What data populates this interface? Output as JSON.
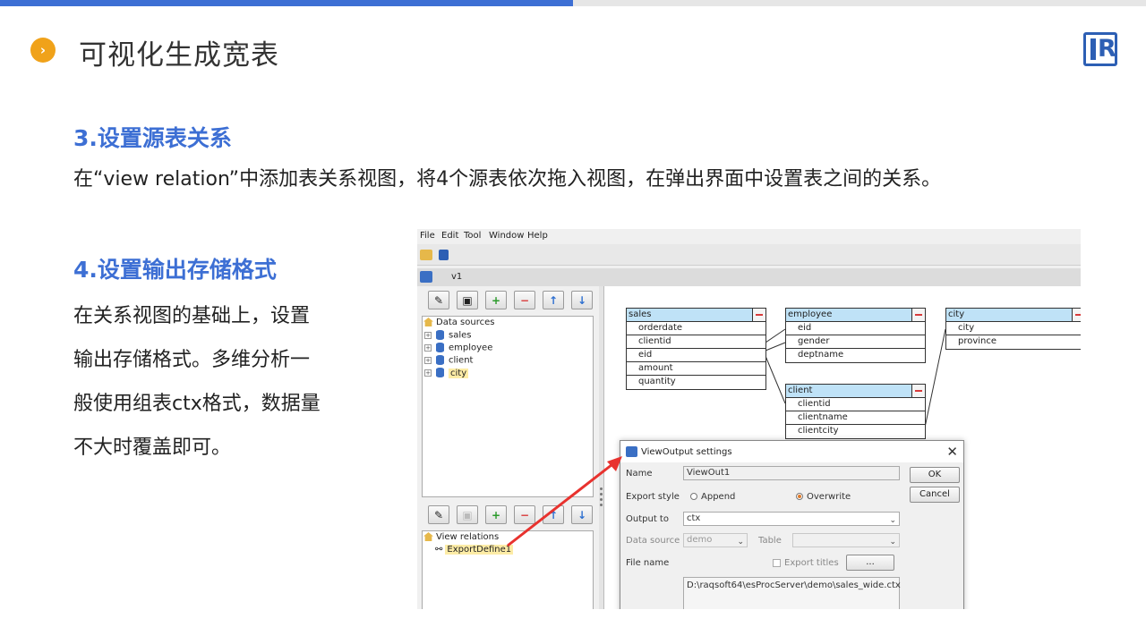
{
  "slide": {
    "title": "可视化生成宽表",
    "title_icon": "chevron-right-icon",
    "accent_color": "#3d6fd4",
    "icon_color": "#f0a21a",
    "logo_letter": "R"
  },
  "section3": {
    "heading": "3.设置源表关系",
    "text": "在“view relation”中添加表关系视图，将4个源表依次拖入视图，在弹出界面中设置表之间的关系。"
  },
  "section4": {
    "heading": "4.设置输出存储格式",
    "lines": [
      "在关系视图的基础上，设置",
      "输出存储格式。多维分析一",
      "般使用组表ctx格式，数据量",
      "不大时覆盖即可。"
    ]
  },
  "app": {
    "menu": [
      "File",
      "Edit",
      "Tool",
      "Window",
      "Help"
    ],
    "tab": "v1",
    "data_sources_label": "Data sources",
    "data_sources": [
      "sales",
      "employee",
      "client",
      "city"
    ],
    "view_relations_label": "View relations",
    "view_relation_item": "ExportDefine1",
    "tables": {
      "sales": {
        "name": "sales",
        "fields": [
          "orderdate",
          "clientid",
          "eid",
          "amount",
          "quantity"
        ]
      },
      "employee": {
        "name": "employee",
        "fields": [
          "eid",
          "gender",
          "deptname"
        ]
      },
      "city": {
        "name": "city",
        "fields": [
          "city",
          "province"
        ]
      },
      "client": {
        "name": "client",
        "fields": [
          "clientid",
          "clientname",
          "clientcity"
        ]
      }
    },
    "dialog": {
      "title": "ViewOutput settings",
      "name_label": "Name",
      "name_value": "ViewOut1",
      "ok": "OK",
      "cancel": "Cancel",
      "export_style_label": "Export style",
      "append": "Append",
      "overwrite": "Overwrite",
      "output_to_label": "Output to",
      "output_to_value": "ctx",
      "data_source_label": "Data source",
      "data_source_value": "demo",
      "table_label": "Table",
      "file_name_label": "File name",
      "export_titles": "Export titles",
      "browse": "...",
      "file_path": "D:\\raqsoft64\\esProcServer\\demo\\sales_wide.ctx"
    }
  }
}
